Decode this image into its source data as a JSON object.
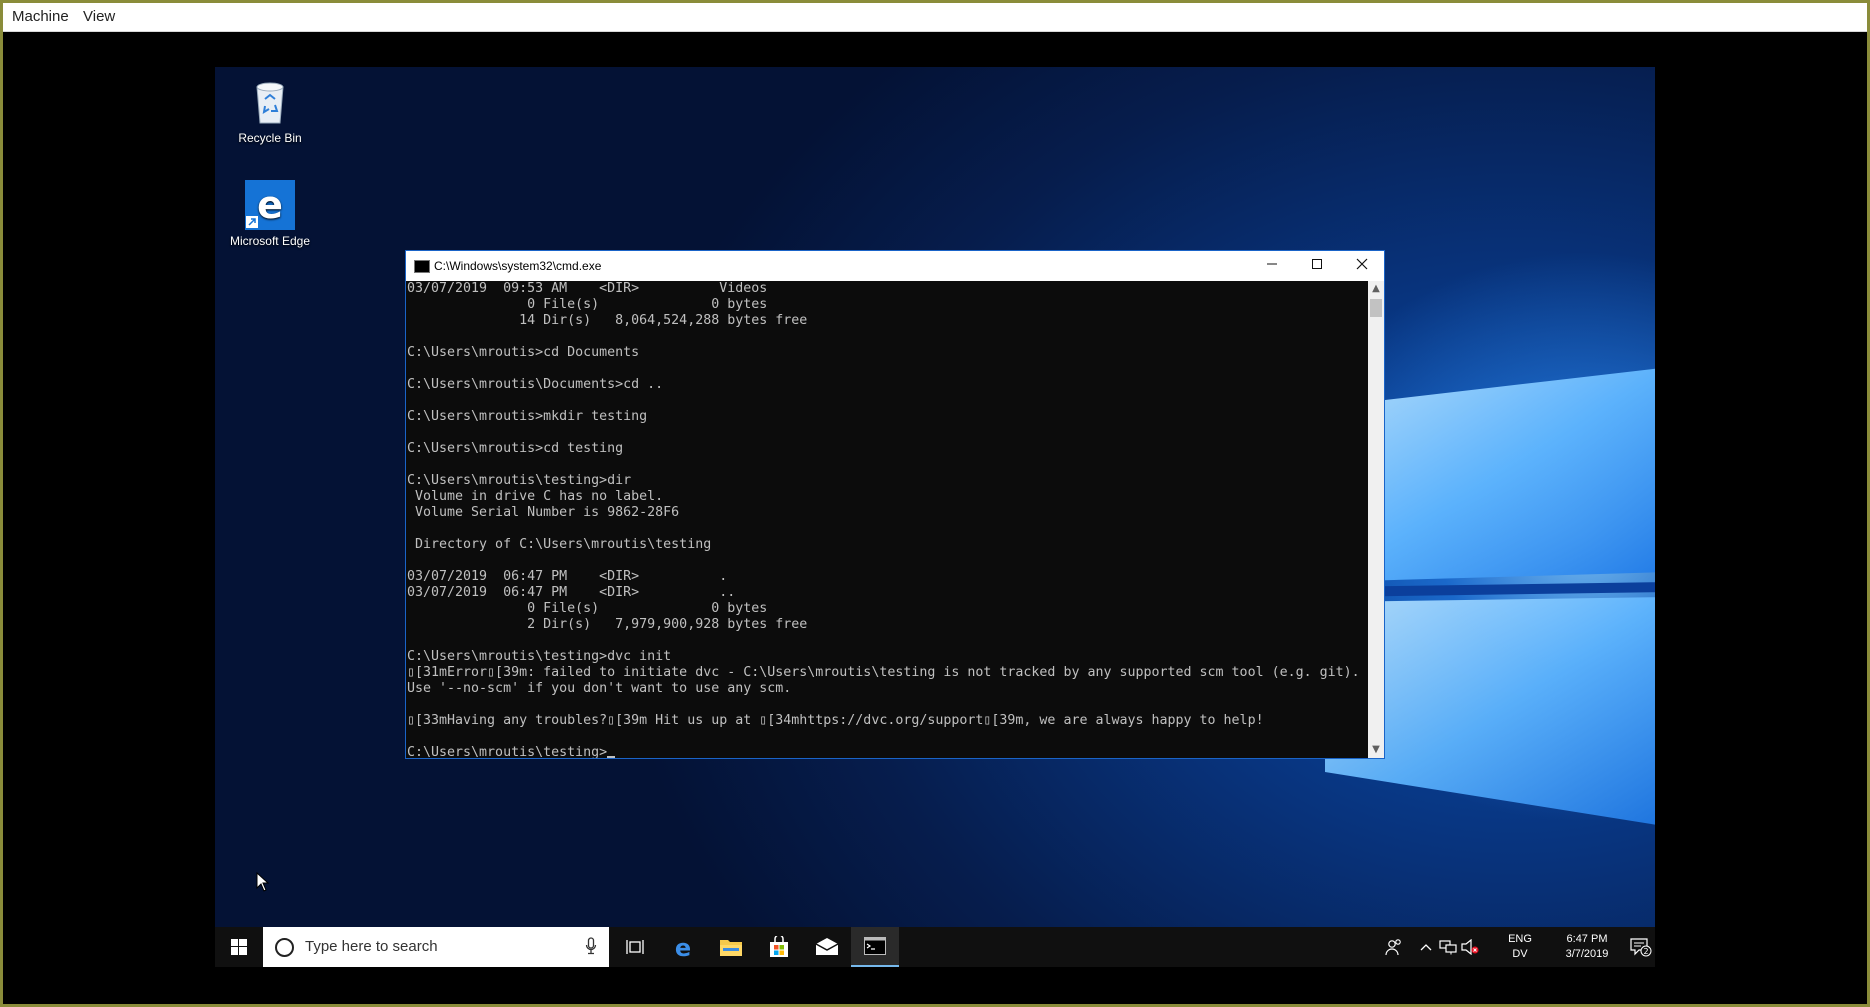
{
  "host": {
    "menu": [
      "Machine",
      "View"
    ]
  },
  "desktop": {
    "icons": [
      {
        "label": "Recycle Bin"
      },
      {
        "label": "Microsoft Edge"
      }
    ]
  },
  "cmd": {
    "title": "C:\\Windows\\system32\\cmd.exe",
    "lines": [
      "03/07/2019  09:53 AM    <DIR>          Videos",
      "               0 File(s)              0 bytes",
      "              14 Dir(s)   8,064,524,288 bytes free",
      "",
      "C:\\Users\\mroutis>cd Documents",
      "",
      "C:\\Users\\mroutis\\Documents>cd ..",
      "",
      "C:\\Users\\mroutis>mkdir testing",
      "",
      "C:\\Users\\mroutis>cd testing",
      "",
      "C:\\Users\\mroutis\\testing>dir",
      " Volume in drive C has no label.",
      " Volume Serial Number is 9862-28F6",
      "",
      " Directory of C:\\Users\\mroutis\\testing",
      "",
      "03/07/2019  06:47 PM    <DIR>          .",
      "03/07/2019  06:47 PM    <DIR>          ..",
      "               0 File(s)              0 bytes",
      "               2 Dir(s)   7,979,900,928 bytes free",
      "",
      "C:\\Users\\mroutis\\testing>dvc init",
      "▯[31mError▯[39m: failed to initiate dvc - C:\\Users\\mroutis\\testing is not tracked by any supported scm tool (e.g. git).",
      "Use '--no-scm' if you don't want to use any scm.",
      "",
      "▯[33mHaving any troubles?▯[39m Hit us up at ▯[34mhttps://dvc.org/support▯[39m, we are always happy to help!",
      ""
    ],
    "prompt": "C:\\Users\\mroutis\\testing>"
  },
  "taskbar": {
    "search_placeholder": "Type here to search",
    "lang_line1": "ENG",
    "lang_line2": "DV",
    "time": "6:47 PM",
    "date": "3/7/2019",
    "notification_count": "2"
  },
  "colors": {
    "taskbar_bg": "#101010",
    "console_bg": "#0c0c0c",
    "console_fg": "#c0c0c0",
    "accent": "#76b9ed",
    "host_border": "#8a8c3a"
  }
}
